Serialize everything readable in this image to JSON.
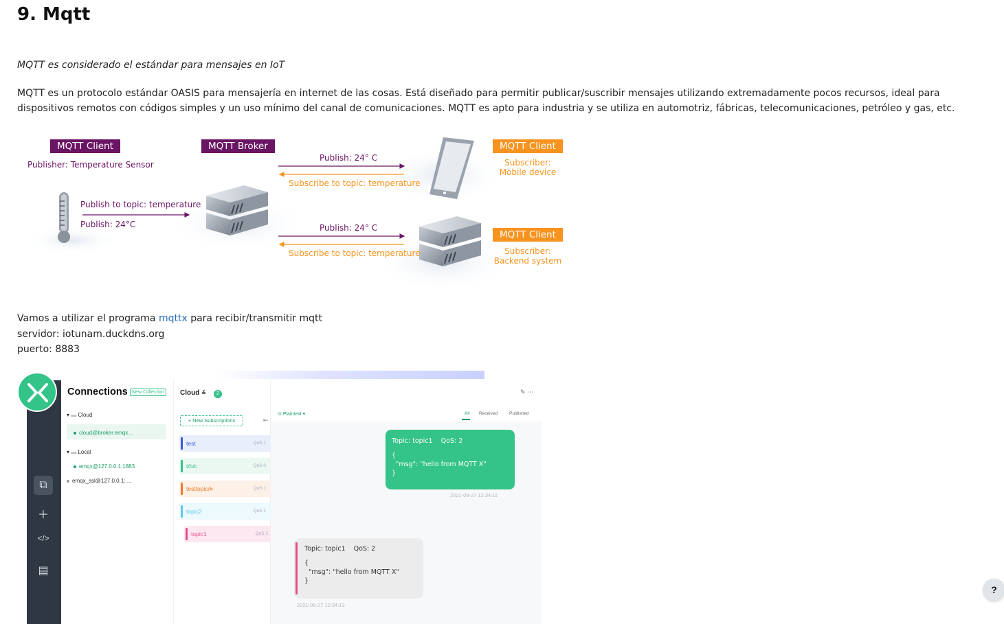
{
  "page": {
    "title": "9. Mqtt",
    "subtitle": "MQTT es considerado el estándar para mensajes en IoT",
    "intro": "MQTT es un protocolo estándar OASIS para mensajería en internet de las cosas. Está diseñado para permitir publicar/suscribir mensajes utilizando extremadamente pocos recursos, ideal para dispositivos remotos con códigos simples y un uso mínimo del canal de comunicaciones. MQTT es apto para industria y se utiliza en automotriz, fábricas, telecomunicaciones, petróleo y gas, etc.",
    "info": {
      "line1_prefix": "Vamos a utilizar el programa ",
      "link_text": "mqttx",
      "line1_suffix": " para recibir/transmitir mqtt",
      "server": "servidor: iotunam.duckdns.org",
      "port": "puerto: 8883"
    }
  },
  "diagram": {
    "client_pub_tag": "MQTT Client",
    "client_pub_desc": "Publisher: Temperature Sensor",
    "broker_tag": "MQTT Broker",
    "publish_topic": "Publish to topic: temperature",
    "publish_value": "Publish: 24°C",
    "mobile": {
      "tag": "MQTT Client",
      "desc_line1": "Subscriber:",
      "desc_line2": "Mobile device",
      "publish": "Publish: 24° C",
      "subscribe": "Subscribe to topic: temperature"
    },
    "backend": {
      "tag": "MQTT Client",
      "desc_line1": "Subscriber:",
      "desc_line2": "Backend system",
      "publish": "Publish: 24° C",
      "subscribe": "Subscribe to topic: temperature"
    },
    "colors": {
      "purple": "#6a1464",
      "orange": "#f7931e"
    }
  },
  "mqttx": {
    "connections_title": "Connections",
    "new_collection": "New Collection",
    "tree": {
      "cloud_folder": "Cloud",
      "cloud_conn": "cloud@broker.emqx...",
      "local_folder": "Local",
      "local_conn": "emqx@127.0.0.1:1883",
      "ssl_conn": "emqx_ssl@127.0.0.1: ..."
    },
    "active_conn_title": "Cloud",
    "active_conn_count": "2",
    "new_subscription": "+ New Subscriptions",
    "subscriptions": [
      {
        "topic": "test",
        "qos": "QoS 1",
        "color": "#3b5bdb",
        "bg": "#e9eefb"
      },
      {
        "topic": "t/b/c",
        "qos": "QoS 0",
        "color": "#34c388",
        "bg": "#eaf8f1"
      },
      {
        "topic": "testtopic/#",
        "qos": "QoS 1",
        "color": "#ee7a2d",
        "bg": "#fdf0e6"
      },
      {
        "topic": "topic2",
        "qos": "QoS 1",
        "color": "#5bc9e8",
        "bg": "#ecf9fd"
      },
      {
        "topic": "topic1",
        "qos": "QoS 2",
        "color": "#e44c8b",
        "bg": "#fde8f1"
      }
    ],
    "payload_format": "Plaintext",
    "filter_tabs": [
      "All",
      "Received",
      "Published"
    ],
    "sent_message": {
      "header": "Topic: topic1    QoS: 2",
      "line1": "{",
      "line2": "  \"msg\": \"hello from MQTT X\"",
      "line3": "}",
      "time": "2021-09-27  12:34:11"
    },
    "received_message": {
      "header": "Topic: topic1    QoS: 2",
      "line1": "{",
      "line2": "  \"msg\": \"hello from MQTT X\"",
      "line3": "}",
      "time": "2021-09-27  12:34:13"
    }
  },
  "help_label": "?"
}
